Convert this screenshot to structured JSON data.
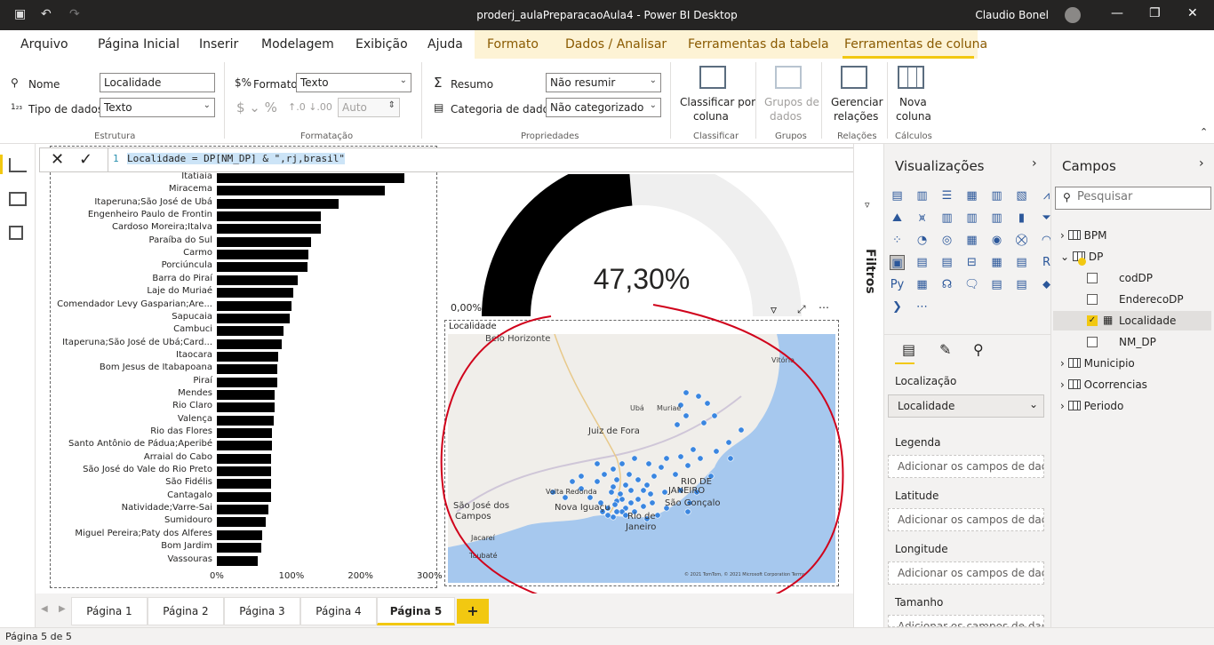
{
  "titlebar": {
    "title": "proderj_aulaPreparacaoAula4 - Power BI Desktop",
    "user": "Claudio Bonel"
  },
  "tabs": [
    "Arquivo",
    "Página Inicial",
    "Inserir",
    "Modelagem",
    "Exibição",
    "Ajuda",
    "Formato",
    "Dados / Analisar",
    "Ferramentas da tabela",
    "Ferramentas de coluna"
  ],
  "ribbon": {
    "nome_label": "Nome",
    "nome_value": "Localidade",
    "tipo_label": "Tipo de dados",
    "tipo_value": "Texto",
    "estrutura": "Estrutura",
    "formato_label": "Formato",
    "formato_value": "Texto",
    "auto_value": "Auto",
    "formatacao": "Formatação",
    "resumo_label": "Resumo",
    "resumo_value": "Não resumir",
    "categoria_label": "Categoria de dados",
    "categoria_value": "Não categorizado",
    "propriedades": "Propriedades",
    "classificar_l1": "Classificar por",
    "classificar_l2": "coluna",
    "classificar_group": "Classificar",
    "grupos_l1": "Grupos de",
    "grupos_l2": "dados",
    "grupos_group": "Grupos",
    "gerenciar_l1": "Gerenciar",
    "gerenciar_l2": "relações",
    "relacoes_group": "Relações",
    "nova_l1": "Nova",
    "nova_l2": "coluna",
    "calculos_group": "Cálculos"
  },
  "formula": {
    "line": "1",
    "code": "Localidade = DP[NM_DP] & \",rj,brasil\""
  },
  "chart_data": {
    "type": "bar",
    "orientation": "horizontal",
    "categories": [
      "Itatiaia",
      "Miracema",
      "Itaperuna;São José de Ubá",
      "Engenheiro Paulo de Frontin",
      "Cardoso Moreira;Italva",
      "Paraíba do Sul",
      "Carmo",
      "Porciúncula",
      "Barra do Piraí",
      "Laje do Muriaé",
      "Comendador Levy Gasparian;Are...",
      "Sapucaia",
      "Cambuci",
      "Itaperuna;São José de Ubá;Card...",
      "Itaocara",
      "Bom Jesus de Itabapoana",
      "Piraí",
      "Mendes",
      "Rio Claro",
      "Valença",
      "Rio das Flores",
      "Santo Antônio de Pádua;Aperibé",
      "Arraial do Cabo",
      "São José do Vale do Rio Preto",
      "São Fidélis",
      "Cantagalo",
      "Natividade;Varre-Sai",
      "Sumidouro",
      "Miguel Pereira;Paty dos Alferes",
      "Bom Jardim",
      "Vassouras"
    ],
    "values": [
      272,
      243,
      177,
      150,
      150,
      136,
      132,
      131,
      117,
      111,
      108,
      106,
      96,
      94,
      89,
      88,
      87,
      84,
      84,
      83,
      80,
      80,
      79,
      79,
      79,
      78,
      75,
      71,
      66,
      65,
      59
    ],
    "xticks": [
      "0%",
      "100%",
      "200%",
      "300%"
    ],
    "xlim": [
      0,
      300
    ]
  },
  "gauge": {
    "value": 47.3,
    "value_label": "47,30%",
    "min_label": "0,00%"
  },
  "map": {
    "title": "Localidade",
    "labels": [
      "Belo Horizonte",
      "Vitória",
      "Ubá",
      "Muriaé",
      "Juiz de Fora",
      "RIO DE",
      "JANEIRO",
      "Volta Redonda",
      "São José dos",
      "Campos",
      "Nova Iguaçu",
      "São Gonçalo",
      "Rio de",
      "Janeiro",
      "Jacareí",
      "Taubaté"
    ],
    "attribution": "© 2021 TomTom, © 2021 Microsoft Corporation Terms"
  },
  "pages": [
    "Página 1",
    "Página 2",
    "Página 3",
    "Página 4",
    "Página 5"
  ],
  "add_page": "+",
  "status": "Página 5 de 5",
  "filters_label": "Filtros",
  "viz": {
    "title": "Visualizações",
    "wells": [
      {
        "label": "Localização",
        "value": "Localidade"
      },
      {
        "label": "Legenda",
        "value": "Adicionar os campos de dad..."
      },
      {
        "label": "Latitude",
        "value": "Adicionar os campos de dad..."
      },
      {
        "label": "Longitude",
        "value": "Adicionar os campos de dad..."
      },
      {
        "label": "Tamanho",
        "value": "Adicionar os campos de dad..."
      }
    ],
    "icons": [
      "R",
      "Py"
    ]
  },
  "fields": {
    "title": "Campos",
    "search_placeholder": "Pesquisar",
    "tables": [
      "BPM",
      "DP",
      "Municipio",
      "Ocorrencias",
      "Periodo"
    ],
    "dp_columns": [
      "codDP",
      "EnderecoDP",
      "Localidade",
      "NM_DP"
    ]
  },
  "accent_color": "#f2c811",
  "annotation_color": "#d0021b",
  "map_point_color": "#3a86e0"
}
